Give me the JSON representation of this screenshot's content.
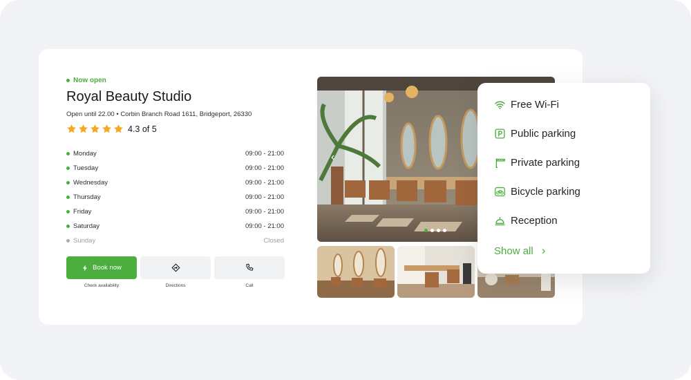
{
  "business": {
    "status": "Now open",
    "name": "Royal Beauty Studio",
    "address": "Open until 22.00 • Corbin Branch Road 1611, Bridgeport, 26330",
    "rating_text": "4.3 of 5",
    "rating_value": 4.3,
    "rating_max": 5
  },
  "hours": [
    {
      "day": "Monday",
      "time": "09:00 - 21:00"
    },
    {
      "day": "Tuesday",
      "time": "09:00 - 21:00"
    },
    {
      "day": "Wednesday",
      "time": "09:00 - 21:00"
    },
    {
      "day": "Thursday",
      "time": "09:00 - 21:00"
    },
    {
      "day": "Friday",
      "time": "09:00 - 21:00"
    },
    {
      "day": "Saturday",
      "time": "09:00 - 21:00"
    },
    {
      "day": "Sunday",
      "time": "Closed"
    }
  ],
  "actions": {
    "book_label": "Book now",
    "book_caption": "Check availability",
    "directions_caption": "Directions",
    "call_caption": "Call"
  },
  "gallery": {
    "active_slide": 1,
    "slide_count": 4
  },
  "amenities": {
    "items": [
      {
        "label": "Free Wi-Fi",
        "icon": "wifi-icon"
      },
      {
        "label": "Public parking",
        "icon": "parking-icon"
      },
      {
        "label": "Private parking",
        "icon": "barrier-icon"
      },
      {
        "label": "Bicycle parking",
        "icon": "bicycle-icon"
      },
      {
        "label": "Reception",
        "icon": "bell-icon"
      }
    ],
    "show_all": "Show all"
  },
  "colors": {
    "accent": "#4cae3e",
    "background": "#f2f3f6",
    "star": "#f6a821"
  }
}
